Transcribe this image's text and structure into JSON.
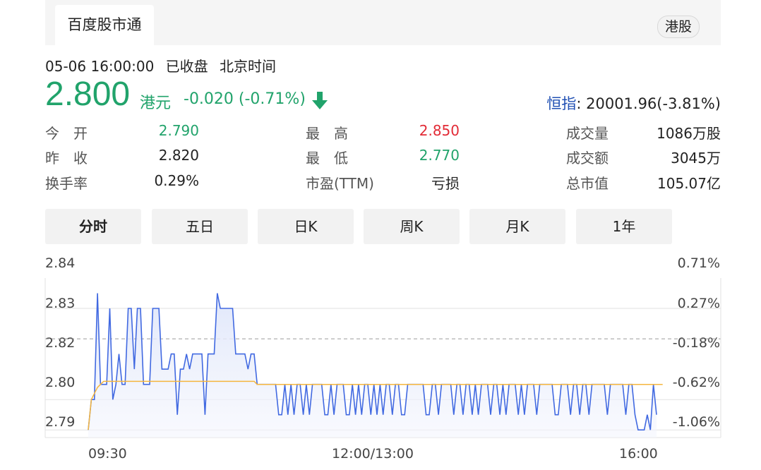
{
  "header": {
    "tab_label": "百度股市通",
    "market_badge": "港股"
  },
  "meta": {
    "timestamp": "05-06 16:00:00",
    "status": "已收盘",
    "timezone": "北京时间"
  },
  "quote": {
    "price": "2.800",
    "currency": "港元",
    "change": "-0.020 (-0.71%)",
    "direction": "down",
    "color": "#21a36b"
  },
  "index": {
    "label": "恒指",
    "value": ": 20001.96(-3.81%)"
  },
  "stats": {
    "open_label": "今　开",
    "open": "2.790",
    "prev_close_label": "昨　收",
    "prev_close": "2.820",
    "turnover_rate_label": "换手率",
    "turnover_rate": "0.29%",
    "high_label": "最　高",
    "high": "2.850",
    "low_label": "最　低",
    "low": "2.770",
    "pe_label": "市盈(TTM)",
    "pe": "亏损",
    "volume_label": "成交量",
    "volume": "1086万股",
    "amount_label": "成交额",
    "amount": "3045万",
    "market_cap_label": "总市值",
    "market_cap": "105.07亿"
  },
  "period_tabs": [
    "分时",
    "五日",
    "日K",
    "周K",
    "月K",
    "1年"
  ],
  "active_tab": "分时",
  "chart_data": {
    "type": "line",
    "y_ticks": [
      "2.84",
      "2.83",
      "2.82",
      "2.80",
      "2.79"
    ],
    "y_ticks_right": [
      "0.71%",
      "0.27%",
      "-0.18%",
      "-0.62%",
      "-1.06%"
    ],
    "x_ticks": [
      "09:30",
      "12:00/13:00",
      "16:00"
    ],
    "ylim": [
      2.7875,
      2.84
    ],
    "prev_close": 2.82,
    "colors": {
      "price": "#4169e1",
      "avg": "#f5b63e",
      "fill": "#dfe6fa"
    },
    "series": [
      {
        "values": [
          2.79,
          2.8,
          2.8,
          2.835,
          2.805,
          2.805,
          2.805,
          2.83,
          2.8,
          2.805,
          2.815,
          2.805,
          2.805,
          2.83,
          2.83,
          2.81,
          2.83,
          2.83,
          2.805,
          2.805,
          2.805,
          2.83,
          2.83,
          2.83,
          2.81,
          2.81,
          2.81,
          2.815,
          2.815,
          2.795,
          2.81,
          2.81,
          2.815,
          2.81,
          2.815,
          2.815,
          2.815,
          2.815,
          2.795,
          2.815,
          2.815,
          2.815,
          2.835,
          2.83,
          2.83,
          2.83,
          2.83,
          2.83,
          2.815,
          2.815,
          2.815,
          2.815,
          2.81,
          2.815,
          2.815,
          2.805,
          2.805,
          2.805,
          2.805,
          2.805,
          2.805,
          2.805,
          2.795,
          2.795,
          2.805,
          2.795,
          2.805,
          2.795,
          2.805,
          2.805,
          2.795,
          2.805,
          2.795,
          2.805,
          2.805,
          2.805,
          2.805,
          2.795,
          2.795,
          2.805,
          2.795,
          2.805,
          2.805,
          2.805,
          2.795,
          2.795,
          2.805,
          2.795,
          2.805,
          2.795,
          2.805,
          2.805,
          2.795,
          2.805,
          2.795,
          2.805,
          2.795,
          2.805,
          2.805,
          2.795,
          2.805,
          2.805,
          2.795,
          2.795,
          2.805,
          2.805,
          2.805,
          2.805,
          2.805,
          2.805,
          2.795,
          2.795,
          2.805,
          2.805,
          2.795,
          2.805,
          2.805,
          2.805,
          2.805,
          2.795,
          2.805,
          2.805,
          2.795,
          2.805,
          2.805,
          2.795,
          2.805,
          2.795,
          2.805,
          2.805,
          2.805,
          2.795,
          2.805,
          2.805,
          2.795,
          2.805,
          2.795,
          2.805,
          2.805,
          2.805,
          2.795,
          2.805,
          2.795,
          2.805,
          2.805,
          2.805,
          2.795,
          2.805,
          2.805,
          2.805,
          2.805,
          2.805,
          2.795,
          2.795,
          2.805,
          2.805,
          2.805,
          2.795,
          2.805,
          2.805,
          2.795,
          2.805,
          2.805,
          2.795,
          2.805,
          2.805,
          2.805,
          2.805,
          2.805,
          2.795,
          2.805,
          2.805,
          2.805,
          2.805,
          2.805,
          2.795,
          2.805,
          2.805,
          2.795,
          2.79,
          2.79,
          2.79,
          2.795,
          2.79,
          2.805,
          2.795
        ]
      },
      {
        "values": [
          2.79,
          2.8,
          2.802,
          2.804,
          2.805,
          2.806,
          2.806,
          2.806,
          2.806,
          2.806,
          2.806,
          2.806,
          2.806,
          2.806,
          2.806,
          2.806,
          2.806,
          2.806,
          2.806,
          2.806,
          2.806,
          2.806,
          2.806,
          2.806,
          2.806,
          2.806,
          2.806,
          2.806,
          2.806,
          2.806,
          2.806,
          2.806,
          2.806,
          2.806,
          2.806,
          2.806,
          2.806,
          2.806,
          2.806,
          2.806,
          2.806,
          2.806,
          2.806,
          2.806,
          2.806,
          2.806,
          2.806,
          2.806,
          2.806,
          2.806,
          2.806,
          2.806,
          2.806,
          2.806,
          2.806,
          2.805,
          2.805,
          2.805,
          2.805,
          2.805,
          2.805,
          2.805,
          2.805,
          2.805,
          2.805,
          2.805,
          2.805,
          2.805,
          2.805,
          2.805,
          2.805,
          2.805,
          2.805,
          2.805,
          2.805,
          2.805,
          2.805,
          2.805,
          2.805,
          2.805,
          2.805,
          2.805,
          2.805,
          2.805,
          2.805,
          2.805,
          2.805,
          2.805,
          2.805,
          2.805,
          2.805,
          2.805,
          2.805,
          2.805,
          2.805,
          2.805,
          2.805,
          2.805,
          2.805,
          2.805,
          2.805,
          2.805,
          2.805,
          2.805,
          2.805,
          2.805,
          2.805,
          2.805,
          2.805,
          2.805,
          2.805,
          2.805,
          2.805,
          2.805,
          2.805,
          2.805,
          2.805,
          2.805,
          2.805,
          2.805,
          2.805,
          2.805,
          2.805,
          2.805,
          2.805,
          2.805,
          2.805,
          2.805,
          2.805,
          2.805,
          2.805,
          2.805,
          2.805,
          2.805,
          2.805,
          2.805,
          2.805,
          2.805,
          2.805,
          2.805,
          2.805,
          2.805,
          2.805,
          2.805,
          2.805,
          2.805,
          2.805,
          2.805,
          2.805,
          2.805,
          2.805,
          2.805,
          2.805,
          2.805,
          2.805,
          2.805,
          2.805,
          2.805,
          2.805,
          2.805,
          2.805,
          2.805,
          2.805,
          2.805,
          2.805,
          2.805,
          2.805,
          2.805,
          2.805,
          2.805,
          2.805,
          2.805,
          2.805,
          2.805,
          2.805,
          2.805,
          2.805,
          2.805,
          2.805,
          2.805,
          2.805,
          2.805,
          2.805,
          2.805,
          2.805,
          2.805,
          2.805,
          2.805
        ]
      }
    ]
  }
}
